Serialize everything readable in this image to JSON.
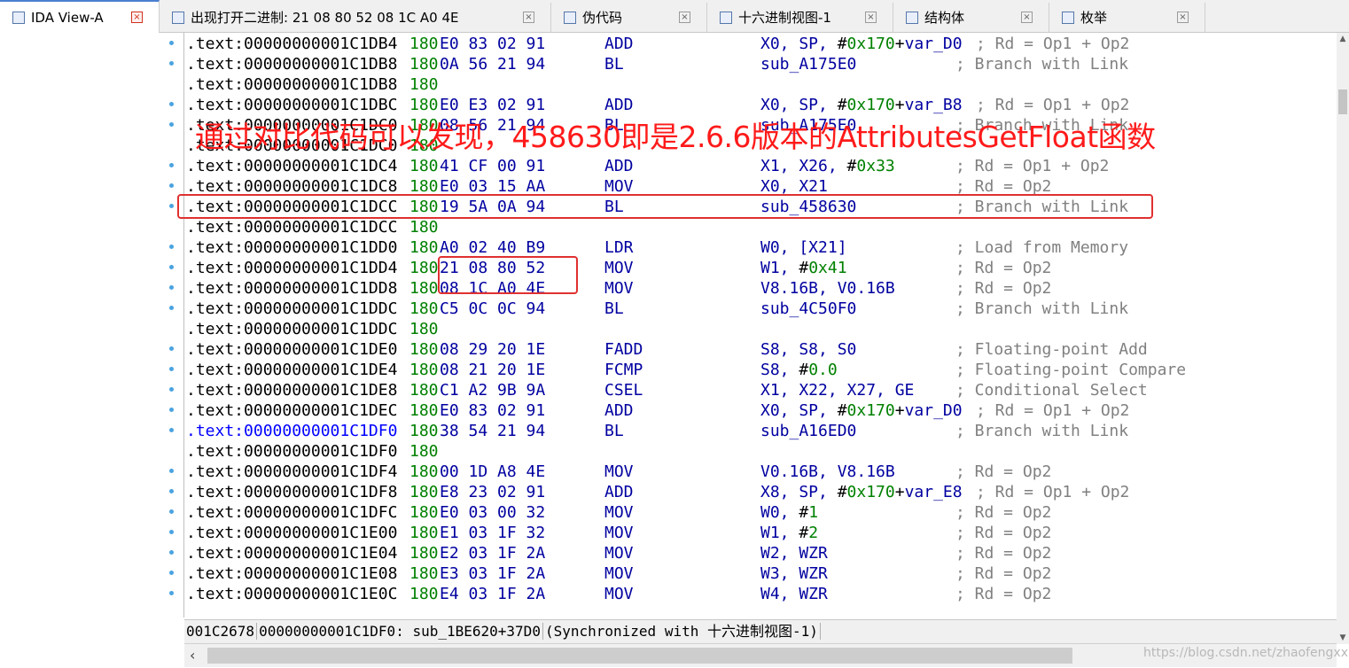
{
  "tabs": [
    {
      "label": "IDA View-A",
      "active": true,
      "icon": "ida-view-icon"
    },
    {
      "label": "出现打开二进制: 21 08 80 52 08 1C A0 4E",
      "active": false,
      "icon": "search-result-icon"
    },
    {
      "label": "伪代码",
      "active": false,
      "icon": "pseudocode-icon"
    },
    {
      "label": "十六进制视图-1",
      "active": false,
      "icon": "hex-view-icon"
    },
    {
      "label": "结构体",
      "active": false,
      "icon": "structures-icon"
    },
    {
      "label": "枚举",
      "active": false,
      "icon": "enums-icon"
    }
  ],
  "close_glyph": "×",
  "lines": [
    {
      "addr": ".text:00000000001C1DB4",
      "seg": "180",
      "bytes": "E0 83 02 91",
      "mnemonic": "ADD",
      "operands": "X0, SP, #0x170+var_D0",
      "comment": "; Rd = Op1 + Op2",
      "dot": true
    },
    {
      "addr": ".text:00000000001C1DB8",
      "seg": "180",
      "bytes": "0A 56 21 94",
      "mnemonic": "BL",
      "operands": "sub_A175E0",
      "comment": "; Branch with Link",
      "dot": true
    },
    {
      "addr": ".text:00000000001C1DB8",
      "seg": "180",
      "bytes": "",
      "mnemonic": "",
      "operands": "",
      "comment": "",
      "dot": false
    },
    {
      "addr": ".text:00000000001C1DBC",
      "seg": "180",
      "bytes": "E0 E3 02 91",
      "mnemonic": "ADD",
      "operands": "X0, SP, #0x170+var_B8",
      "comment": "; Rd = Op1 + Op2",
      "dot": true
    },
    {
      "addr": ".text:00000000001C1DC0",
      "seg": "180",
      "bytes": "08 56 21 94",
      "mnemonic": "BL",
      "operands": "sub_A175E0",
      "comment": "; Branch with Link",
      "dot": true
    },
    {
      "addr": ".text:00000000001C1DC0",
      "seg": "180",
      "bytes": "",
      "mnemonic": "",
      "operands": "",
      "comment": "",
      "dot": false
    },
    {
      "addr": ".text:00000000001C1DC4",
      "seg": "180",
      "bytes": "41 CF 00 91",
      "mnemonic": "ADD",
      "operands": "X1, X26, #0x33",
      "comment": "; Rd = Op1 + Op2",
      "dot": true
    },
    {
      "addr": ".text:00000000001C1DC8",
      "seg": "180",
      "bytes": "E0 03 15 AA",
      "mnemonic": "MOV",
      "operands": "X0, X21",
      "comment": "; Rd = Op2",
      "dot": true
    },
    {
      "addr": ".text:00000000001C1DCC",
      "seg": "180",
      "bytes": "19 5A 0A 94",
      "mnemonic": "BL",
      "operands": "sub_458630",
      "comment": "; Branch with Link",
      "dot": true
    },
    {
      "addr": ".text:00000000001C1DCC",
      "seg": "180",
      "bytes": "",
      "mnemonic": "",
      "operands": "",
      "comment": "",
      "dot": false
    },
    {
      "addr": ".text:00000000001C1DD0",
      "seg": "180",
      "bytes": "A0 02 40 B9",
      "mnemonic": "LDR",
      "operands": "W0, [X21]",
      "comment": "; Load from Memory",
      "dot": true
    },
    {
      "addr": ".text:00000000001C1DD4",
      "seg": "180",
      "bytes": "21 08 80 52",
      "mnemonic": "MOV",
      "operands": "W1, #0x41",
      "comment": "; Rd = Op2",
      "dot": true
    },
    {
      "addr": ".text:00000000001C1DD8",
      "seg": "180",
      "bytes": "08 1C A0 4E",
      "mnemonic": "MOV",
      "operands": "V8.16B, V0.16B",
      "comment": "; Rd = Op2",
      "dot": true
    },
    {
      "addr": ".text:00000000001C1DDC",
      "seg": "180",
      "bytes": "C5 0C 0C 94",
      "mnemonic": "BL",
      "operands": "sub_4C50F0",
      "comment": "; Branch with Link",
      "dot": true
    },
    {
      "addr": ".text:00000000001C1DDC",
      "seg": "180",
      "bytes": "",
      "mnemonic": "",
      "operands": "",
      "comment": "",
      "dot": false
    },
    {
      "addr": ".text:00000000001C1DE0",
      "seg": "180",
      "bytes": "08 29 20 1E",
      "mnemonic": "FADD",
      "operands": "S8, S8, S0",
      "comment": "; Floating-point Add",
      "dot": true
    },
    {
      "addr": ".text:00000000001C1DE4",
      "seg": "180",
      "bytes": "08 21 20 1E",
      "mnemonic": "FCMP",
      "operands": "S8, #0.0",
      "comment": "; Floating-point Compare",
      "dot": true
    },
    {
      "addr": ".text:00000000001C1DE8",
      "seg": "180",
      "bytes": "C1 A2 9B 9A",
      "mnemonic": "CSEL",
      "operands": "X1, X22, X27, GE",
      "comment": "; Conditional Select",
      "dot": true
    },
    {
      "addr": ".text:00000000001C1DEC",
      "seg": "180",
      "bytes": "E0 83 02 91",
      "mnemonic": "ADD",
      "operands": "X0, SP, #0x170+var_D0",
      "comment": "; Rd = Op1 + Op2",
      "dot": true
    },
    {
      "addr": ".text:00000000001C1DF0",
      "seg": "180",
      "bytes": "38 54 21 94",
      "mnemonic": "BL",
      "operands": "sub_A16ED0",
      "comment": "; Branch with Link",
      "dot": true,
      "highlight": true
    },
    {
      "addr": ".text:00000000001C1DF0",
      "seg": "180",
      "bytes": "",
      "mnemonic": "",
      "operands": "",
      "comment": "",
      "dot": false
    },
    {
      "addr": ".text:00000000001C1DF4",
      "seg": "180",
      "bytes": "00 1D A8 4E",
      "mnemonic": "MOV",
      "operands": "V0.16B, V8.16B",
      "comment": "; Rd = Op2",
      "dot": true
    },
    {
      "addr": ".text:00000000001C1DF8",
      "seg": "180",
      "bytes": "E8 23 02 91",
      "mnemonic": "ADD",
      "operands": "X8, SP, #0x170+var_E8",
      "comment": "; Rd = Op1 + Op2",
      "dot": true
    },
    {
      "addr": ".text:00000000001C1DFC",
      "seg": "180",
      "bytes": "E0 03 00 32",
      "mnemonic": "MOV",
      "operands": "W0, #1",
      "comment": "; Rd = Op2",
      "dot": true
    },
    {
      "addr": ".text:00000000001C1E00",
      "seg": "180",
      "bytes": "E1 03 1F 32",
      "mnemonic": "MOV",
      "operands": "W1, #2",
      "comment": "; Rd = Op2",
      "dot": true
    },
    {
      "addr": ".text:00000000001C1E04",
      "seg": "180",
      "bytes": "E2 03 1F 2A",
      "mnemonic": "MOV",
      "operands": "W2, WZR",
      "comment": "; Rd = Op2",
      "dot": true
    },
    {
      "addr": ".text:00000000001C1E08",
      "seg": "180",
      "bytes": "E3 03 1F 2A",
      "mnemonic": "MOV",
      "operands": "W3, WZR",
      "comment": "; Rd = Op2",
      "dot": true
    },
    {
      "addr": ".text:00000000001C1E0C",
      "seg": "180",
      "bytes": "E4 03 1F 2A",
      "mnemonic": "MOV",
      "operands": "W4, WZR",
      "comment": "; Rd = Op2",
      "dot": true
    }
  ],
  "annotation": "通过对比代码可以发现，458630即是2.6.6版本的AttributesGetFloat函数",
  "status": {
    "offset": "001C2678",
    "location": "00000000001C1DF0: sub_1BE620+37D0",
    "sync": "(Synchronized with 十六进制视图-1)"
  },
  "watermark": "https://blog.csdn.net/zhaofengxx",
  "scroll_arrows": {
    "up": "▲",
    "down": "▼",
    "left": "‹"
  },
  "colors": {
    "address": "#000000",
    "segment": "#008000",
    "instruction": "#0000a0",
    "number": "#008000",
    "comment": "#808080",
    "annotation": "#ff1a1a",
    "highlight_box": "#e03030",
    "selected_address": "#0000ff"
  }
}
